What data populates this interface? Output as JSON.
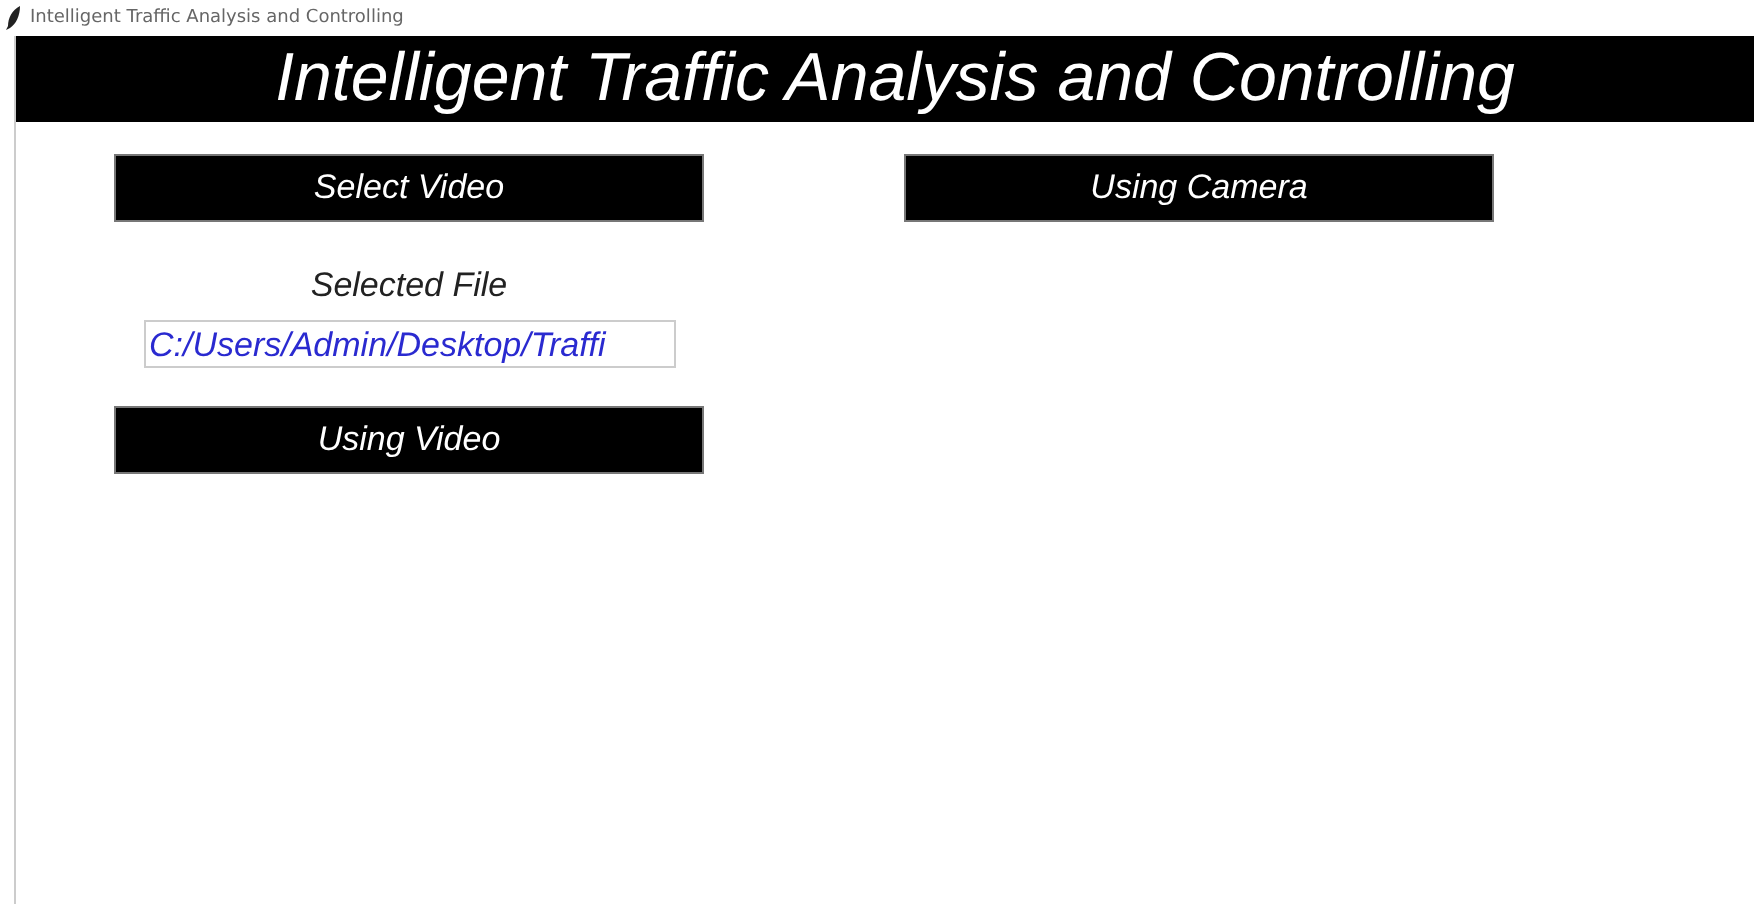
{
  "window": {
    "title": "Intelligent Traffic Analysis and Controlling"
  },
  "header": {
    "title": "Intelligent Traffic Analysis and Controlling"
  },
  "left_panel": {
    "select_button": "Select Video",
    "selected_label": "Selected File",
    "file_path": {
      "value": "C:/Users/Admin/Desktop/Traffi"
    },
    "run_button": "Using Video"
  },
  "right_panel": {
    "camera_button": "Using Camera"
  }
}
